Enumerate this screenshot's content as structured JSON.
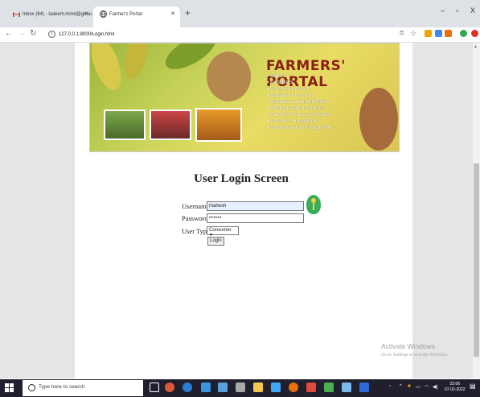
{
  "browser": {
    "tabs": [
      {
        "label": "Inbox (64) - kaleem.mmd@gmai",
        "icon": "gmail-icon",
        "active": false
      },
      {
        "label": "Farmer's Portal",
        "icon": "globe-icon",
        "active": true
      }
    ],
    "url": "127.0.0.1:8000/Login.html",
    "window_controls": {
      "minimize": "–",
      "maximize": "▫",
      "close": "X"
    }
  },
  "banner": {
    "title": "FARMERS' PORTAL",
    "items": [
      "Seeds",
      "Fertilizers",
      "Farm Equipment",
      "Agromet Advisory",
      "Agriculture Market Price",
      "Package and Practices",
      "Farmers' Success Stories",
      "Farmers' Handbook",
      "Schemes and Programme"
    ]
  },
  "login": {
    "title": "User Login Screen",
    "username_label": "Username",
    "username_value": "mahesh",
    "password_label": "Password",
    "password_value": "••••••",
    "usertype_label": "User Type",
    "usertype_selected": "Consumer",
    "login_button": "Login"
  },
  "watermark": {
    "title": "Activate Windows",
    "subtitle": "Go to Settings to activate Windows."
  },
  "taskbar": {
    "search_placeholder": "Type here to search",
    "time": "23:06",
    "date": "07-02-2022"
  },
  "colors": {
    "accent_green": "#3aad5a",
    "banner_title": "#8a1f14",
    "taskbar": "#1f1f2e"
  }
}
